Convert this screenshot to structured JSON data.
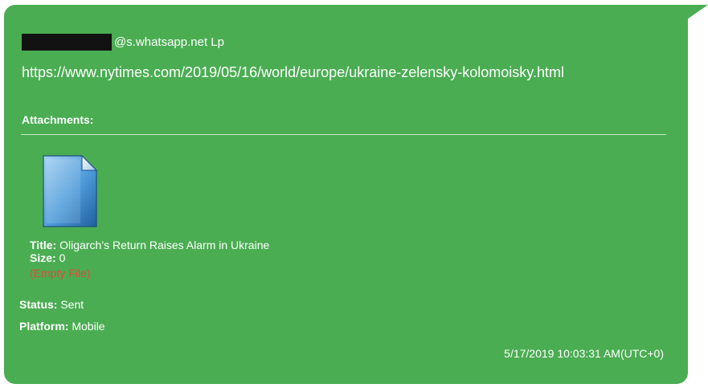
{
  "message": {
    "sender_suffix": "@s.whatsapp.net Lp",
    "url_text": "https://www.nytimes.com/2019/05/16/world/europe/ukraine-zelensky-kolomoisky.html",
    "attachments_label": "Attachments:",
    "attachment": {
      "icon": "document-icon",
      "title_label": "Title:",
      "title_value": "Oligarch’s Return Raises Alarm in Ukraine",
      "size_label": "Size:",
      "size_value": "0",
      "empty_note": "(Empty File)"
    },
    "status_label": "Status:",
    "status_value": "Sent",
    "platform_label": "Platform:",
    "platform_value": "Mobile",
    "timestamp": "5/17/2019 10:03:31 AM(UTC+0)"
  },
  "colors": {
    "bubble": "#4aad52",
    "redaction": "#121212",
    "empty_file_text": "#e04a3a",
    "text": "#ffffff"
  }
}
